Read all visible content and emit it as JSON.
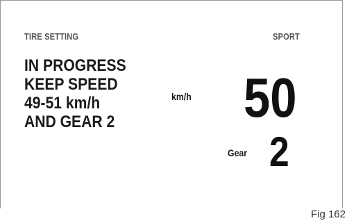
{
  "display": {
    "header_left": "TIRE SETTING",
    "header_right": "SPORT",
    "message_lines": [
      "IN PROGRESS",
      "KEEP SPEED",
      "49-51 km/h",
      "AND GEAR 2"
    ],
    "speed_unit": "km/h",
    "speed_value": "50",
    "gear_label": "Gear",
    "gear_value": "2"
  },
  "caption": "Fig 162"
}
